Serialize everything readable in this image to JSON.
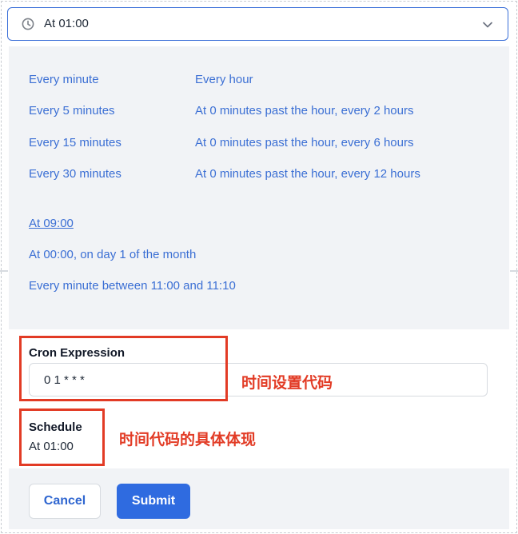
{
  "select": {
    "value": "At 01:00",
    "icon": "clock-icon",
    "chevron_icon": "chevron-down-icon",
    "border_color": "#3a6fd8"
  },
  "options": {
    "left_column": [
      "Every minute",
      "Every 5 minutes",
      "Every 15 minutes",
      "Every 30 minutes"
    ],
    "right_column": [
      "Every hour",
      "At 0 minutes past the hour, every 2 hours",
      "At 0 minutes past the hour, every 6 hours",
      "At 0 minutes past the hour, every 12 hours"
    ],
    "extra": [
      "At 09:00",
      "At 00:00, on day 1 of the month",
      "Every minute between 11:00 and 11:10"
    ],
    "link_color": "#3b6fd4"
  },
  "cron": {
    "label": "Cron Expression",
    "value": "0 1 * * *"
  },
  "schedule": {
    "label": "Schedule",
    "value": "At 01:00"
  },
  "annotations": {
    "cron_note": "时间设置代码",
    "schedule_note": "时间代码的具体体现",
    "color": "#e23b25"
  },
  "footer": {
    "cancel_label": "Cancel",
    "submit_label": "Submit",
    "submit_color": "#2f6be0"
  }
}
